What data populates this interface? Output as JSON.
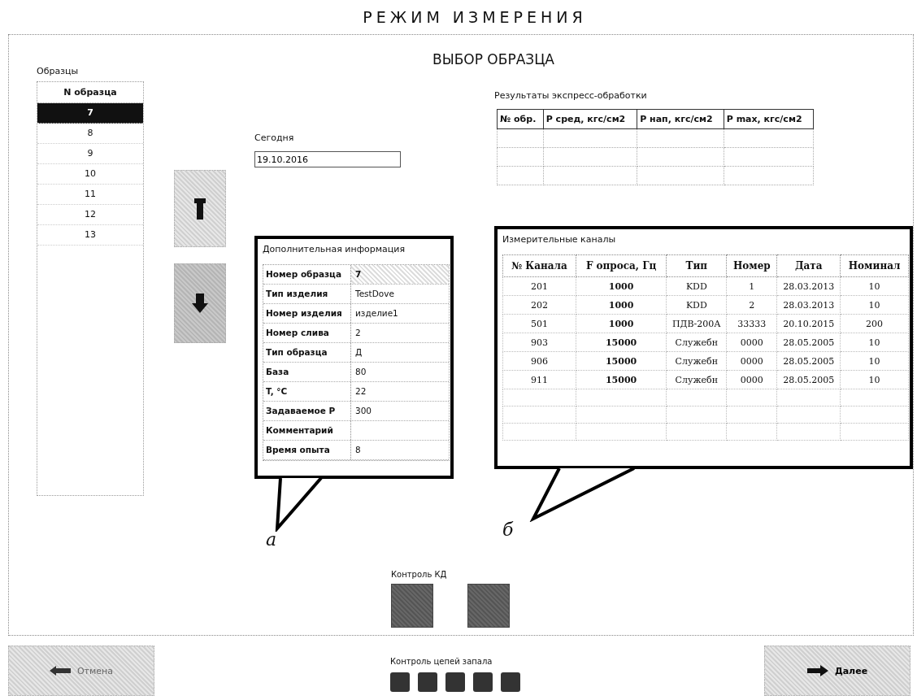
{
  "header": {
    "title": "РЕЖИМ ИЗМЕРЕНИЯ"
  },
  "screen_title": "ВЫБОР ОБРАЗЦА",
  "samples": {
    "label": "Образцы",
    "column": "N образца",
    "rows": [
      {
        "number": "7",
        "selected": true
      },
      {
        "number": "8",
        "selected": false
      },
      {
        "number": "9",
        "selected": false
      },
      {
        "number": "10",
        "selected": false
      },
      {
        "number": "11",
        "selected": false
      },
      {
        "number": "12",
        "selected": false
      },
      {
        "number": "13",
        "selected": false
      }
    ]
  },
  "today": {
    "label": "Сегодня",
    "value": "19.10.2016"
  },
  "results": {
    "label": "Результаты экспресс-обработки",
    "columns": [
      "№ обр.",
      "P сред, кгс/см2",
      "P нап, кгс/см2",
      "P max, кгс/см2"
    ]
  },
  "additional_info": {
    "label": "Дополнительная информация",
    "rows": [
      {
        "name": "Номер образца",
        "value": "7"
      },
      {
        "name": "Тип изделия",
        "value": "TestDove"
      },
      {
        "name": "Номер изделия",
        "value": "изделие1"
      },
      {
        "name": "Номер слива",
        "value": "2"
      },
      {
        "name": "Тип образца",
        "value": "Д"
      },
      {
        "name": "База",
        "value": "80"
      },
      {
        "name": "T, °C",
        "value": "22"
      },
      {
        "name": "Задаваемое P",
        "value": "300"
      },
      {
        "name": "Комментарий"
      },
      {
        "name": "Время опыта",
        "value": "8"
      }
    ]
  },
  "channels": {
    "label": "Измерительные каналы",
    "columns": [
      "№ Канала",
      "F опроса, Гц",
      "Тип",
      "Номер",
      "Дата",
      "Номинал"
    ],
    "rows": [
      [
        "201",
        "1000",
        "KDD",
        "1",
        "28.03.2013",
        "10"
      ],
      [
        "202",
        "1000",
        "KDD",
        "2",
        "28.03.2013",
        "10"
      ],
      [
        "501",
        "1000",
        "ПДВ-200А",
        "33333",
        "20.10.2015",
        "200"
      ],
      [
        "903",
        "15000",
        "Служебн",
        "0000",
        "28.05.2005",
        "10"
      ],
      [
        "906",
        "15000",
        "Служебн",
        "0000",
        "28.05.2005",
        "10"
      ],
      [
        "911",
        "15000",
        "Служебн",
        "0000",
        "28.05.2005",
        "10"
      ]
    ]
  },
  "callout_marks": [
    "а",
    "б"
  ],
  "kd_control": {
    "label": "Контроль КД"
  },
  "fuse_control": {
    "label": "Контроль цепей запала"
  },
  "buttons": {
    "cancel": "Отмена",
    "next": "Далее"
  }
}
